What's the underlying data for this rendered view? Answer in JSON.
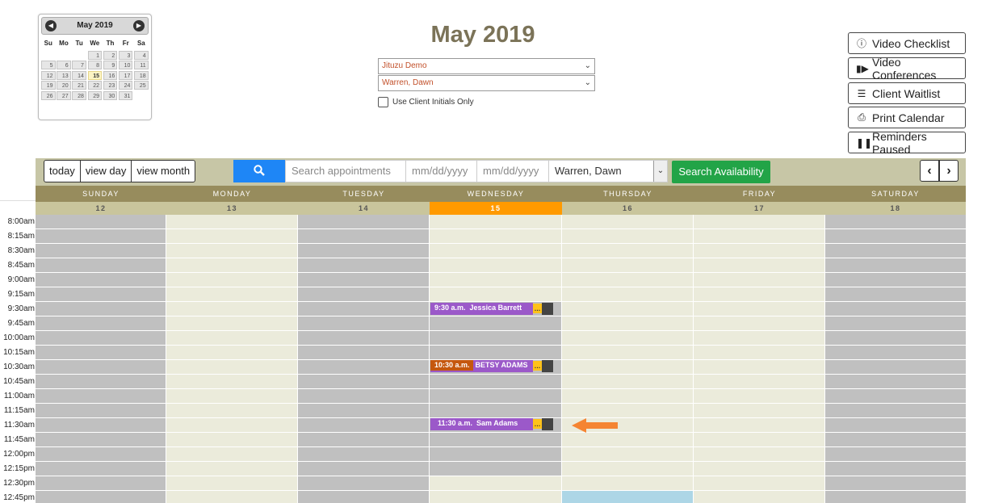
{
  "minical": {
    "title": "May 2019",
    "dow": [
      "Su",
      "Mo",
      "Tu",
      "We",
      "Th",
      "Fr",
      "Sa"
    ],
    "days": [
      "",
      "",
      "",
      "1",
      "2",
      "3",
      "4",
      "5",
      "6",
      "7",
      "8",
      "9",
      "10",
      "11",
      "12",
      "13",
      "14",
      "15",
      "16",
      "17",
      "18",
      "19",
      "20",
      "21",
      "22",
      "23",
      "24",
      "25",
      "26",
      "27",
      "28",
      "29",
      "30",
      "31"
    ],
    "today": "15"
  },
  "header": {
    "title": "May 2019",
    "select_org": "Jituzu Demo",
    "select_provider": "Warren, Dawn",
    "initials_label": "Use Client Initials Only"
  },
  "right_buttons": [
    {
      "label": "Video Checklist",
      "icon": "info-circle-icon"
    },
    {
      "label": "Video Conferences",
      "icon": "video-camera-icon"
    },
    {
      "label": "Client Waitlist",
      "icon": "list-icon"
    },
    {
      "label": "Print Calendar",
      "icon": "printer-icon"
    },
    {
      "label": "Reminders Paused",
      "icon": "pause-icon"
    }
  ],
  "toolbar": {
    "today": "today",
    "view_day": "view day",
    "view_month": "view month",
    "search_placeholder": "Search appointments",
    "date_from_placeholder": "mm/dd/yyyy",
    "date_to_placeholder": "mm/dd/yyyy",
    "provider": "Warren, Dawn",
    "search_availability": "Search Availability"
  },
  "week": {
    "days": [
      "SUNDAY",
      "MONDAY",
      "TUESDAY",
      "WEDNESDAY",
      "THURSDAY",
      "FRIDAY",
      "SATURDAY"
    ],
    "dates": [
      "12",
      "13",
      "14",
      "15",
      "16",
      "17",
      "18"
    ],
    "today_index": 3
  },
  "times": [
    "8:00am",
    "8:15am",
    "8:30am",
    "8:45am",
    "9:00am",
    "9:15am",
    "9:30am",
    "9:45am",
    "10:00am",
    "10:15am",
    "10:30am",
    "10:45am",
    "11:00am",
    "11:15am",
    "11:30am",
    "11:45am",
    "12:00pm",
    "12:15pm",
    "12:30pm",
    "12:45pm"
  ],
  "appointments": [
    {
      "time": "9:30 a.m.",
      "name": "Jessica Barrett",
      "style": "purple"
    },
    {
      "time": "10:30 a.m.",
      "name": "BETSY ADAMS",
      "style": "orange"
    },
    {
      "time": "11:30 a.m.",
      "name": "Sam Adams",
      "style": "purple"
    }
  ],
  "colors": {
    "accent_orange": "#ff9a00",
    "appt_purple": "#9b59c9",
    "search_blue": "#1e86f6",
    "avail_green": "#22a447"
  }
}
